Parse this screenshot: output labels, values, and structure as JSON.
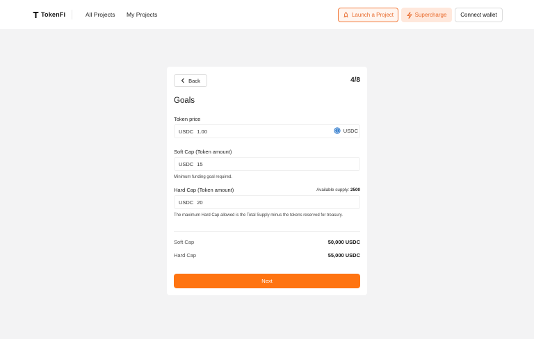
{
  "header": {
    "logo": {
      "text": "TokenFi",
      "icon": "tokenfi-logo-icon"
    },
    "nav": [
      {
        "label": "All Projects"
      },
      {
        "label": "My Projects"
      }
    ],
    "buttons": {
      "launch": {
        "label": "Launch a Project",
        "icon": "rocket-icon"
      },
      "supercharge": {
        "label": "Supercharge",
        "icon": "lightning-icon"
      },
      "wallet": {
        "label": "Connect wallet"
      }
    }
  },
  "form": {
    "back_label": "Back",
    "step": "4/8",
    "title": "Goals",
    "token_price": {
      "label": "Token price",
      "prefix": "USDC",
      "value": "1.00",
      "currency": "USDC",
      "currency_icon": "usdc-icon"
    },
    "soft_cap": {
      "label": "Soft Cap (Token amount)",
      "prefix": "USDC",
      "value": "15",
      "help": "Minimum funding goal required."
    },
    "hard_cap": {
      "label": "Hard Cap (Token amount)",
      "supply_label": "Available supply:",
      "supply_value": "2500",
      "prefix": "USDC",
      "value": "20",
      "help": "The maximum Hard Cap allowed is the Total Supply minus the tokens reserved for treasury."
    },
    "summary": [
      {
        "label": "Soft Cap",
        "value": "50,000 USDC"
      },
      {
        "label": "Hard Cap",
        "value": "55,000 USDC"
      }
    ],
    "next_label": "Next"
  },
  "colors": {
    "accent": "#ff7411",
    "accent_light": "#ffe8dc",
    "background": "#f3f3f4"
  }
}
